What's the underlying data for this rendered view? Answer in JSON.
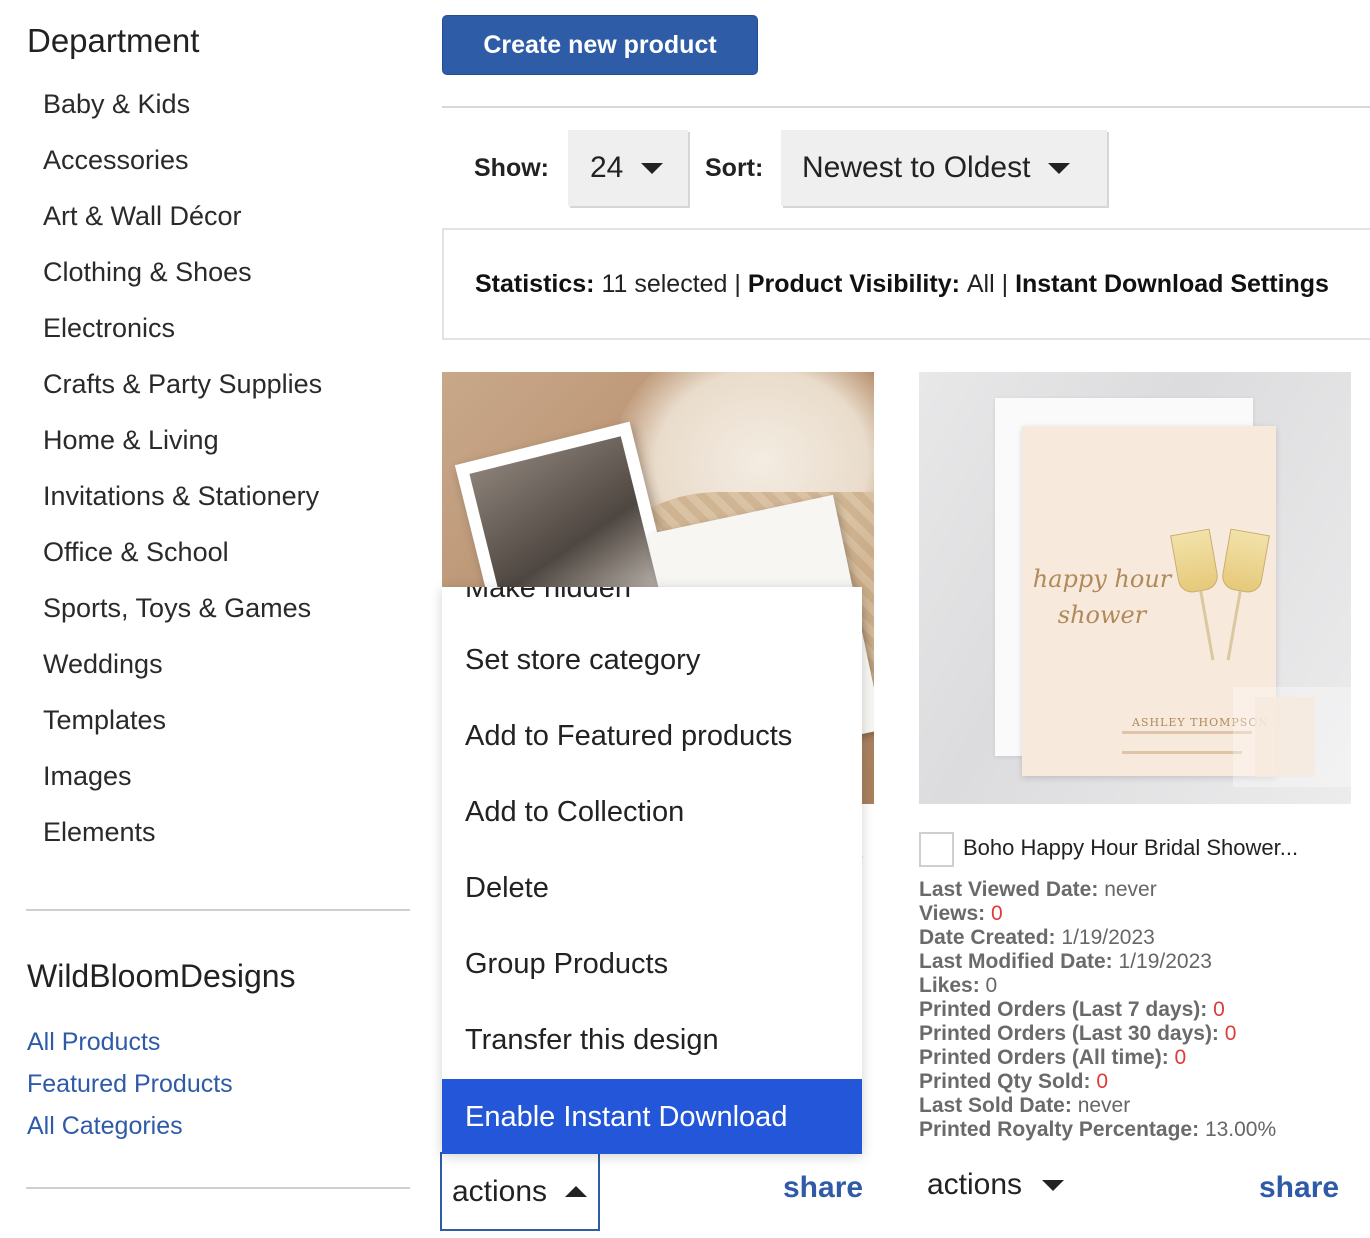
{
  "sidebar": {
    "department_title": "Department",
    "departments": [
      "Baby & Kids",
      "Accessories",
      "Art & Wall Décor",
      "Clothing & Shoes",
      "Electronics",
      "Crafts & Party Supplies",
      "Home & Living",
      "Invitations & Stationery",
      "Office & School",
      "Sports, Toys & Games",
      "Weddings",
      "Templates",
      "Images",
      "Elements"
    ],
    "store_name": "WildBloomDesigns",
    "store_links": [
      "All Products",
      "Featured Products",
      "All Categories"
    ]
  },
  "toolbar": {
    "create_label": "Create new product",
    "show_label": "Show:",
    "show_value": "24",
    "sort_label": "Sort:",
    "sort_value": "Newest to Oldest"
  },
  "stats_bar": {
    "statistics_label": "Statistics:",
    "statistics_value": "11 selected |",
    "visibility_label": "Product Visibility:",
    "visibility_value": "All |",
    "instant_label": "Instant Download Settings"
  },
  "actions_menu": {
    "items": [
      "Make hidden",
      "Set store category",
      "Add to Featured products",
      "Add to Collection",
      "Delete",
      "Group Products",
      "Transfer this design",
      "Enable Instant Download"
    ],
    "highlighted": "Enable Instant Download"
  },
  "products": [
    {
      "title_fragment": ".",
      "actions_label": "actions",
      "share_label": "share"
    },
    {
      "title": "Boho Happy Hour Bridal Shower...",
      "image_text": {
        "script": "happy hour shower",
        "name": "ASHLEY THOMPSON"
      },
      "stats": [
        {
          "label": "Last Viewed Date:",
          "value": "never"
        },
        {
          "label": "Views:",
          "value": "0"
        },
        {
          "label": "Date Created:",
          "value": "1/19/2023"
        },
        {
          "label": "Last Modified Date:",
          "value": "1/19/2023"
        },
        {
          "label": "Likes:",
          "value": "0"
        },
        {
          "label": "Printed Orders (Last 7 days):",
          "value": "0"
        },
        {
          "label": "Printed Orders (Last 30 days):",
          "value": "0"
        },
        {
          "label": "Printed Orders (All time):",
          "value": "0"
        },
        {
          "label": "Printed Qty Sold:",
          "value": "0"
        },
        {
          "label": "Last Sold Date:",
          "value": "never"
        },
        {
          "label": "Printed Royalty Percentage:",
          "value": "13.00%"
        }
      ],
      "actions_label": "actions",
      "share_label": "share"
    }
  ],
  "colors": {
    "brand_blue": "#2e5ca6",
    "link_blue": "#2f5aa8",
    "menu_highlight": "#2356d9",
    "stat_red": "#e03a3a"
  }
}
